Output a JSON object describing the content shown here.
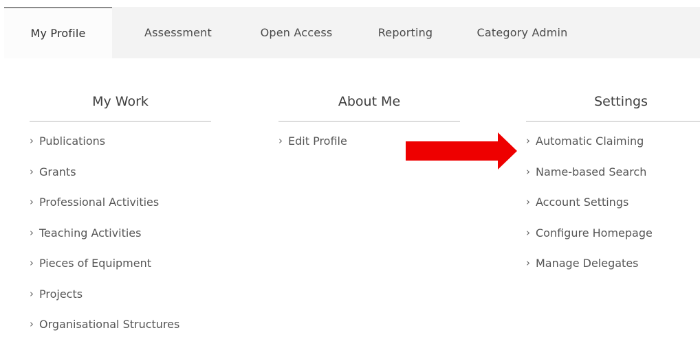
{
  "tabs": [
    {
      "label": "My Profile",
      "active": true
    },
    {
      "label": "Assessment",
      "active": false
    },
    {
      "label": "Open Access",
      "active": false
    },
    {
      "label": "Reporting",
      "active": false
    },
    {
      "label": "Category Admin",
      "active": false
    }
  ],
  "columns": {
    "my_work": {
      "heading": "My Work",
      "links": [
        "Publications",
        "Grants",
        "Professional Activities",
        "Teaching Activities",
        "Pieces of Equipment",
        "Projects",
        "Organisational Structures"
      ]
    },
    "about_me": {
      "heading": "About Me",
      "links": [
        "Edit Profile"
      ]
    },
    "settings": {
      "heading": "Settings",
      "links": [
        "Automatic Claiming",
        "Name-based Search",
        "Account Settings",
        "Configure Homepage",
        "Manage Delegates"
      ]
    }
  },
  "annotation": {
    "icon": "right-arrow-icon",
    "color": "#ee0000"
  },
  "chevron_glyph": "›"
}
